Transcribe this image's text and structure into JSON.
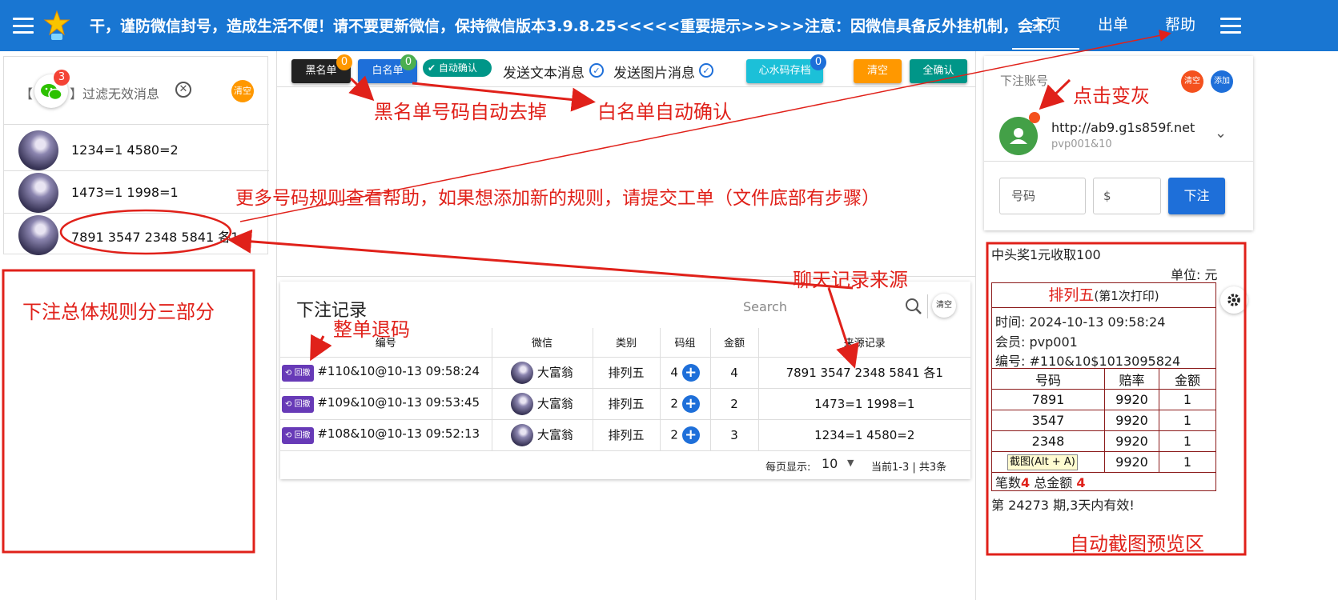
{
  "header": {
    "marquee": "干，谨防微信封号，造成生活不便！请不要更新微信，保持微信版本3.9.8.25<<<<<重要提示>>>>>注意：因微信具备反外挂机制，会不定",
    "nav": [
      "主页",
      "出单",
      "帮助"
    ]
  },
  "chat_panel": {
    "filter_prefix": "【",
    "filter_label": "】过滤无效消息",
    "wechat_badge": "3",
    "clear_label": "清空",
    "messages": [
      "1234=1 4580=2",
      "1473=1 1998=1",
      "7891 3547 2348 5841 各1"
    ]
  },
  "toolbar": {
    "blacklist": "黑名单",
    "blacklist_count": "0",
    "whitelist": "白名单",
    "whitelist_count": "0",
    "auto_confirm": "自动确认",
    "send_text": "发送文本消息",
    "send_image": "发送图片消息",
    "water_code": "心水码存档",
    "water_count": "0",
    "clear": "清空",
    "confirm_all": "全确认"
  },
  "records": {
    "title": "下注记录",
    "search_placeholder": "Search",
    "clear": "清空",
    "columns": [
      "编号",
      "微信",
      "类别",
      "码组",
      "金额",
      "来源记录"
    ],
    "revoke_label": "回撤",
    "rows": [
      {
        "id": "#110&10@10-13 09:58:24",
        "wechat": "大富翁",
        "type": "排列五",
        "groups": "4",
        "amount": "4",
        "source": "7891 3547 2348 5841 各1"
      },
      {
        "id": "#109&10@10-13 09:53:45",
        "wechat": "大富翁",
        "type": "排列五",
        "groups": "2",
        "amount": "2",
        "source": "1473=1 1998=1"
      },
      {
        "id": "#108&10@10-13 09:52:13",
        "wechat": "大富翁",
        "type": "排列五",
        "groups": "2",
        "amount": "3",
        "source": "1234=1 4580=2"
      }
    ],
    "per_page_label": "每页显示:",
    "per_page": "10",
    "range": "当前1-3 | 共3条"
  },
  "account": {
    "title": "下注账号",
    "clear": "清空",
    "add": "添加",
    "url": "http://ab9.g1s859f.net",
    "user": "pvp001&10",
    "number_placeholder": "号码",
    "money_placeholder": "$",
    "bet_button": "下注"
  },
  "preview": {
    "top_line": "中头奖1元收取100",
    "unit": "单位: 元",
    "game": "排列五",
    "print_note": "(第1次打印)",
    "time": "时间: 2024-10-13 09:58:24",
    "member": "会员: pvp001",
    "serial": "编号: #110&10$1013095824",
    "cols": [
      "号码",
      "赔率",
      "金额"
    ],
    "rows": [
      [
        "7891",
        "9920",
        "1"
      ],
      [
        "3547",
        "9920",
        "1"
      ],
      [
        "2348",
        "9920",
        "1"
      ],
      [
        "",
        "9920",
        "1"
      ]
    ],
    "screenshot_tip": "截图(Alt + A)",
    "count_label": "笔数",
    "count": "4",
    "total_label": "总金额",
    "total": "4",
    "period": "第 24273 期,3天内有效!"
  },
  "annotations": {
    "blacklist": "黑名单号码自动去掉",
    "whitelist": "白名单自动确认",
    "rules": "更多号码规则查看帮助，如果想添加新的规则，请提交工单（文件底部有步骤）",
    "click_gray": "点击变灰",
    "bet_rules": "下注总体规则分三部分",
    "chat_source": "聊天记录来源",
    "revoke_all": "整单退码",
    "auto_preview": "自动截图预览区"
  },
  "colors": {
    "primary": "#1976d2",
    "annotation": "#e0211a",
    "blacklist": "#222222",
    "whitelist": "#1e6fd9",
    "auto": "#009688",
    "water": "#1cc0d8",
    "clear": "#ff9800",
    "confirm": "#009688"
  }
}
